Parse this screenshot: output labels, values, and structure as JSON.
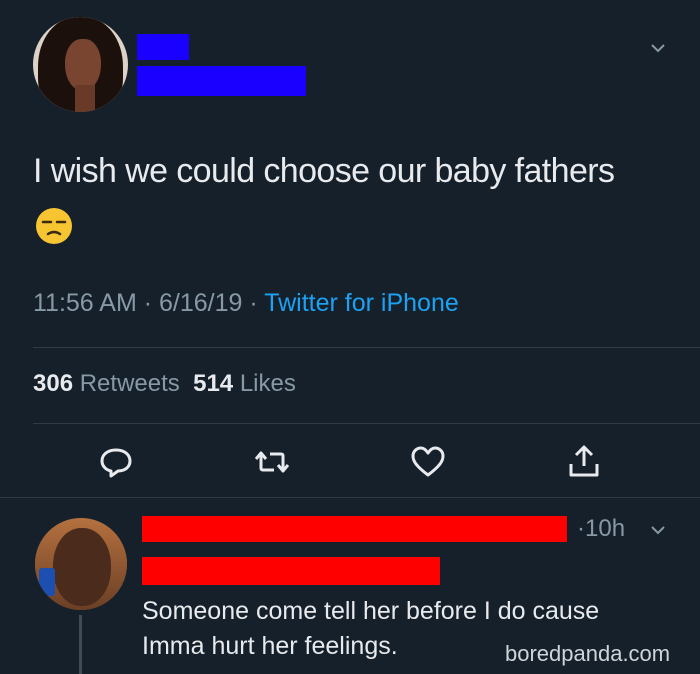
{
  "tweet": {
    "text": "I wish we could choose our baby fathers",
    "emoji": "unamused-face-emoji",
    "time": "11:56 AM",
    "date": "6/16/19",
    "source": "Twitter for iPhone",
    "retweets_count": "306",
    "retweets_label": "Retweets",
    "likes_count": "514",
    "likes_label": "Likes",
    "dot": "·"
  },
  "actions": {
    "reply_icon": "reply-icon",
    "retweet_icon": "retweet-icon",
    "like_icon": "heart-icon",
    "share_icon": "share-icon"
  },
  "reply": {
    "time": "·10h",
    "line1": "Someone come tell her before I do cause",
    "line2": "Imma hurt her feelings."
  },
  "watermark": "boredpanda.com",
  "colors": {
    "background": "#15202b",
    "link": "#1da1f2",
    "secondary": "#8899a6",
    "redact_blue": "#1a00ff",
    "redact_red": "#ff0000"
  }
}
